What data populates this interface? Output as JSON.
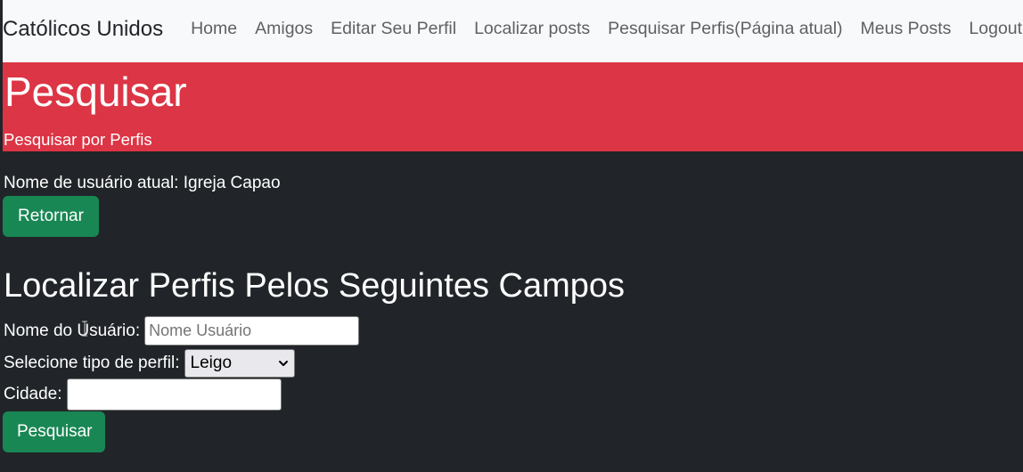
{
  "navbar": {
    "brand": "Católicos Unidos",
    "links": [
      "Home",
      "Amigos",
      "Editar Seu Perfil",
      "Localizar posts",
      "Pesquisar Perfis(Página atual)",
      "Meus Posts",
      "Logout"
    ]
  },
  "hero": {
    "title": "Pesquisar",
    "subtitle": "Pesquisar por Perfis"
  },
  "content": {
    "current_user": "Nome de usuário atual: Igreja Capao",
    "back_button": "Retornar",
    "section_title": "Localizar Perfis Pelos Seguintes Campos",
    "username_label": "Nome do Usuário:",
    "username_placeholder": "Nome Usuário",
    "username_value": "",
    "profile_type_label": "Selecione tipo de perfil:",
    "profile_type_selected": "Leigo",
    "city_label": "Cidade:",
    "city_value": "",
    "search_button": "Pesquisar"
  },
  "colors": {
    "navbar_bg": "#f8f9fa",
    "hero_bg": "#dc3545",
    "page_bg": "#212529",
    "button_bg": "#198754"
  },
  "icons": {
    "select_arrow": "chevron-down-icon",
    "cursor": "text-cursor-icon"
  }
}
